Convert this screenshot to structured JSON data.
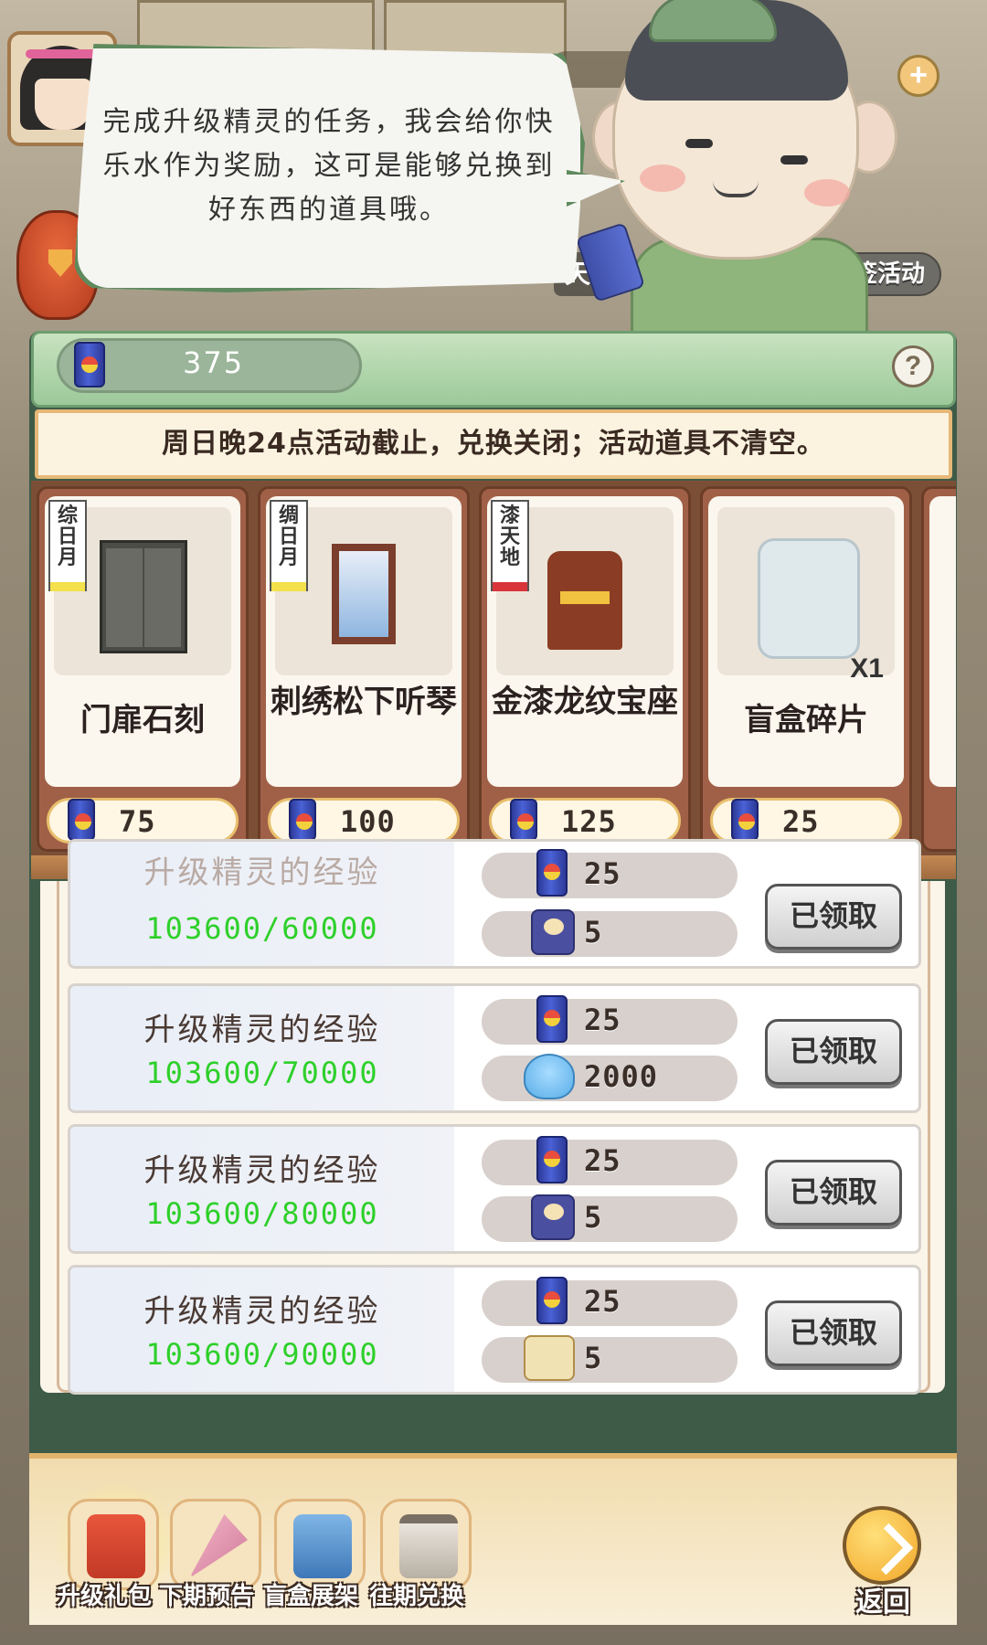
{
  "currency": {
    "amount": "375"
  },
  "npc_dialog": {
    "text": "完成升级精灵的任务，我会给你快乐水作为奖励，这可是能够兑换到好东西的道具哦。"
  },
  "background": {
    "lottery_button": "抽签活动",
    "fragment_text": "天"
  },
  "notice": {
    "text": "周日晚24点活动截止，兑换关闭；活动道具不清空。"
  },
  "shop_items": [
    {
      "name": "门扉石刻",
      "price": "75",
      "tag_lines": [
        "综",
        "日",
        "月"
      ],
      "tag_color": "yellow",
      "quantity": ""
    },
    {
      "name": "刺绣松下听琴",
      "price": "100",
      "tag_lines": [
        "绸",
        "日",
        "月"
      ],
      "tag_color": "yellow",
      "quantity": ""
    },
    {
      "name": "金漆龙纹宝座",
      "price": "125",
      "tag_lines": [
        "漆",
        "天",
        "地"
      ],
      "tag_color": "red",
      "quantity": ""
    },
    {
      "name": "盲盒碎片",
      "price": "25",
      "tag_lines": [],
      "tag_color": "",
      "quantity": "X1"
    }
  ],
  "tasks": [
    {
      "title": "升级精灵的经验",
      "progress": "103600/60000",
      "rewards": [
        {
          "icon": "can-icon",
          "amount": "25"
        },
        {
          "icon": "cat-food-icon",
          "amount": "5"
        }
      ],
      "status": "已领取"
    },
    {
      "title": "升级精灵的经验",
      "progress": "103600/70000",
      "rewards": [
        {
          "icon": "can-icon",
          "amount": "25"
        },
        {
          "icon": "slime-icon",
          "amount": "2000"
        }
      ],
      "status": "已领取"
    },
    {
      "title": "升级精灵的经验",
      "progress": "103600/80000",
      "rewards": [
        {
          "icon": "can-icon",
          "amount": "25"
        },
        {
          "icon": "cat-food-icon",
          "amount": "5"
        }
      ],
      "status": "已领取"
    },
    {
      "title": "升级精灵的经验",
      "progress": "103600/90000",
      "rewards": [
        {
          "icon": "can-icon",
          "amount": "25"
        },
        {
          "icon": "ticket-icon",
          "amount": "5"
        }
      ],
      "status": "已领取"
    }
  ],
  "bottom_nav": [
    {
      "label": "升级礼包",
      "icon": "gift-box-icon"
    },
    {
      "label": "下期预告",
      "icon": "horn-icon"
    },
    {
      "label": "盲盒展架",
      "icon": "display-shelf-icon"
    },
    {
      "label": "往期兑换",
      "icon": "calendar-exchange-icon"
    }
  ],
  "back_button": {
    "label": "返回"
  },
  "colors": {
    "progress_green": "#2ed02a",
    "panel_green": "#3e5b48",
    "notice_border": "#e6b878"
  }
}
